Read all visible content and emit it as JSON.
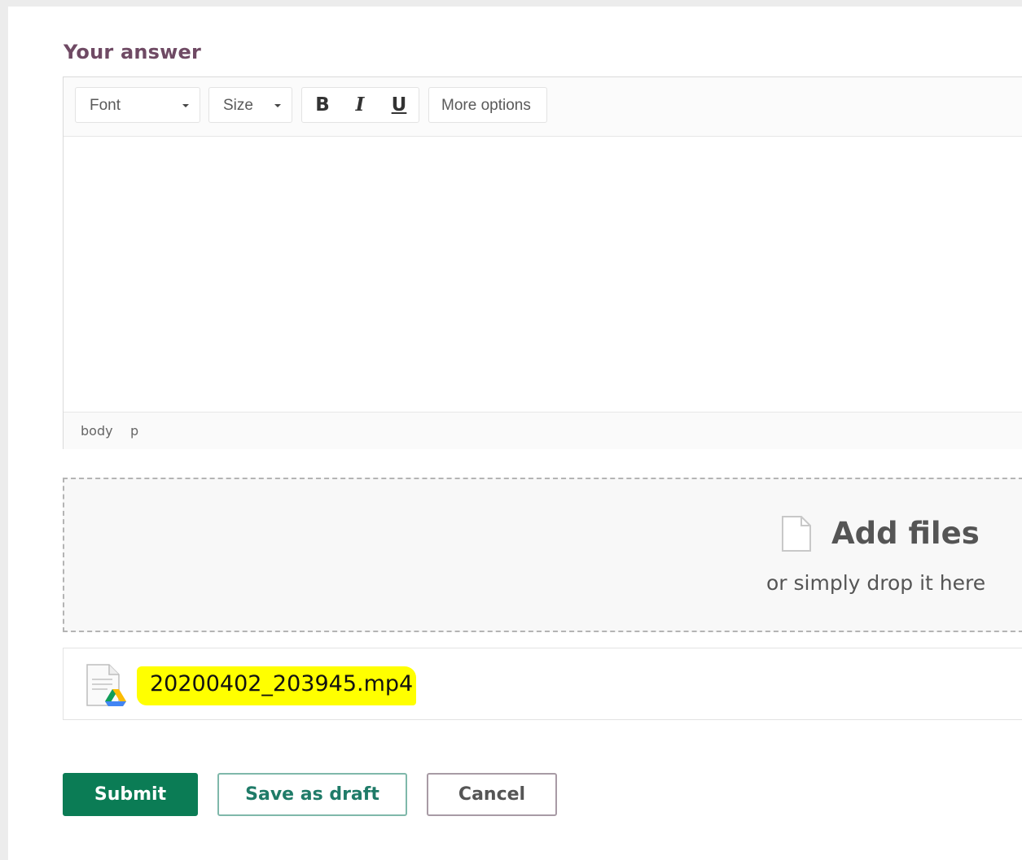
{
  "form": {
    "heading": "Your answer",
    "colors": {
      "heading": "#6f4a64",
      "primary": "#0b7c55",
      "highlight": "#ffff00"
    }
  },
  "editor": {
    "toolbar": {
      "font_label": "Font",
      "size_label": "Size",
      "bold_label": "B",
      "italic_label": "I",
      "underline_label": "U",
      "more_options_label": "More options"
    },
    "content": "",
    "statusbar": {
      "path": [
        "body",
        "p"
      ]
    }
  },
  "dropzone": {
    "icon": "document-icon",
    "title": "Add files",
    "hint": "or simply drop it here"
  },
  "attachments": [
    {
      "icon": "google-drive-file-icon",
      "name": "20200402_203945.mp4",
      "highlighted": true
    }
  ],
  "actions": {
    "submit_label": "Submit",
    "save_draft_label": "Save as draft",
    "cancel_label": "Cancel"
  }
}
